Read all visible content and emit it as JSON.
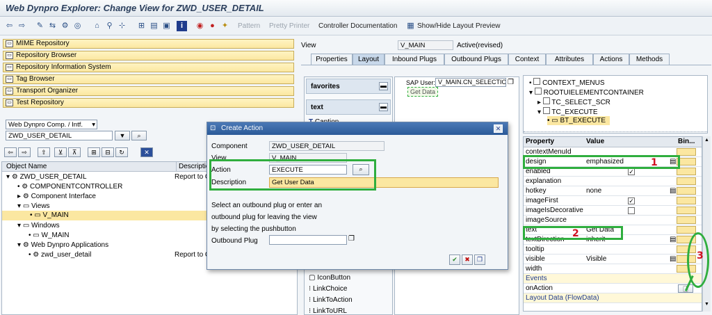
{
  "window": {
    "title": "Web Dynpro Explorer: Change View for ZWD_USER_DETAIL"
  },
  "toolbar": {
    "pattern_label": "Pattern",
    "pretty_printer_label": "Pretty Printer",
    "controller_doc_label": "Controller Documentation",
    "layout_preview_label": "Show/Hide Layout Preview"
  },
  "nav_buttons": [
    "MIME Repository",
    "Repository Browser",
    "Repository Information System",
    "Tag Browser",
    "Transport Organizer",
    "Test Repository"
  ],
  "object_selector": {
    "type_value": "Web Dynpro Comp. / Intf.",
    "name_value": "ZWD_USER_DETAIL"
  },
  "object_tree": {
    "col_name": "Object Name",
    "col_desc": "Descriptio",
    "rows": [
      {
        "label": "ZWD_USER_DETAIL",
        "desc": "Report to C"
      },
      {
        "label": "COMPONENTCONTROLLER",
        "desc": ""
      },
      {
        "label": "Component Interface",
        "desc": ""
      },
      {
        "label": "Views",
        "desc": ""
      },
      {
        "label": "V_MAIN",
        "desc": ""
      },
      {
        "label": "Windows",
        "desc": ""
      },
      {
        "label": "W_MAIN",
        "desc": ""
      },
      {
        "label": "Web Dynpro Applications",
        "desc": ""
      },
      {
        "label": "zwd_user_detail",
        "desc": "Report to C"
      }
    ]
  },
  "view_header": {
    "label": "View",
    "value": "V_MAIN",
    "status": "Active(revised)"
  },
  "tabs": [
    "Properties",
    "Layout",
    "Inbound Plugs",
    "Outbound Plugs",
    "Context",
    "Attributes",
    "Actions",
    "Methods"
  ],
  "palette": {
    "favorites_label": "favorites",
    "text_label": "text",
    "caption_label": "Caption",
    "items": [
      "IconButton",
      "LinkChoice",
      "LinkToAction",
      "LinkToURL"
    ]
  },
  "preview": {
    "sap_user_label": "SAP User:",
    "sap_user_value": "V_MAIN.CN_SELECTION_",
    "button_label": "Get Data"
  },
  "element_tree": [
    "CONTEXT_MENUS",
    "ROOTUIELEMENTCONTAINER",
    "TC_SELECT_SCR",
    "TC_EXECUTE",
    "BT_EXECUTE"
  ],
  "properties": {
    "col_property": "Property",
    "col_value": "Value",
    "col_binding": "Bin...",
    "rows": [
      {
        "name": "contextMenuId",
        "value": ""
      },
      {
        "name": "design",
        "value": "emphasized"
      },
      {
        "name": "enabled",
        "value": ""
      },
      {
        "name": "explanation",
        "value": ""
      },
      {
        "name": "hotkey",
        "value": "none"
      },
      {
        "name": "imageFirst",
        "value": ""
      },
      {
        "name": "imageIsDecorative",
        "value": ""
      },
      {
        "name": "imageSource",
        "value": ""
      },
      {
        "name": "text",
        "value": "Get Data"
      },
      {
        "name": "textDirection",
        "value": "inherit"
      },
      {
        "name": "tooltip",
        "value": ""
      },
      {
        "name": "visible",
        "value": "Visible"
      },
      {
        "name": "width",
        "value": ""
      }
    ],
    "events_label": "Events",
    "onaction_label": "onAction",
    "layout_data_label": "Layout Data (FlowData)"
  },
  "annotations": {
    "one": "1",
    "two": "2",
    "three": "3"
  },
  "dialog": {
    "title": "Create Action",
    "component_label": "Component",
    "component_value": "ZWD_USER_DETAIL",
    "view_label": "View",
    "view_value": "V_MAIN",
    "action_label": "Action",
    "action_value": "EXECUTE",
    "description_label": "Description",
    "description_value": "Get User Data",
    "help_line1": "Select an outbound plug or enter an",
    "help_line2": "outbound plug for leaving the view",
    "help_line3": "by selecting the pushbutton",
    "outbound_label": "Outbound Plug",
    "outbound_value": ""
  }
}
